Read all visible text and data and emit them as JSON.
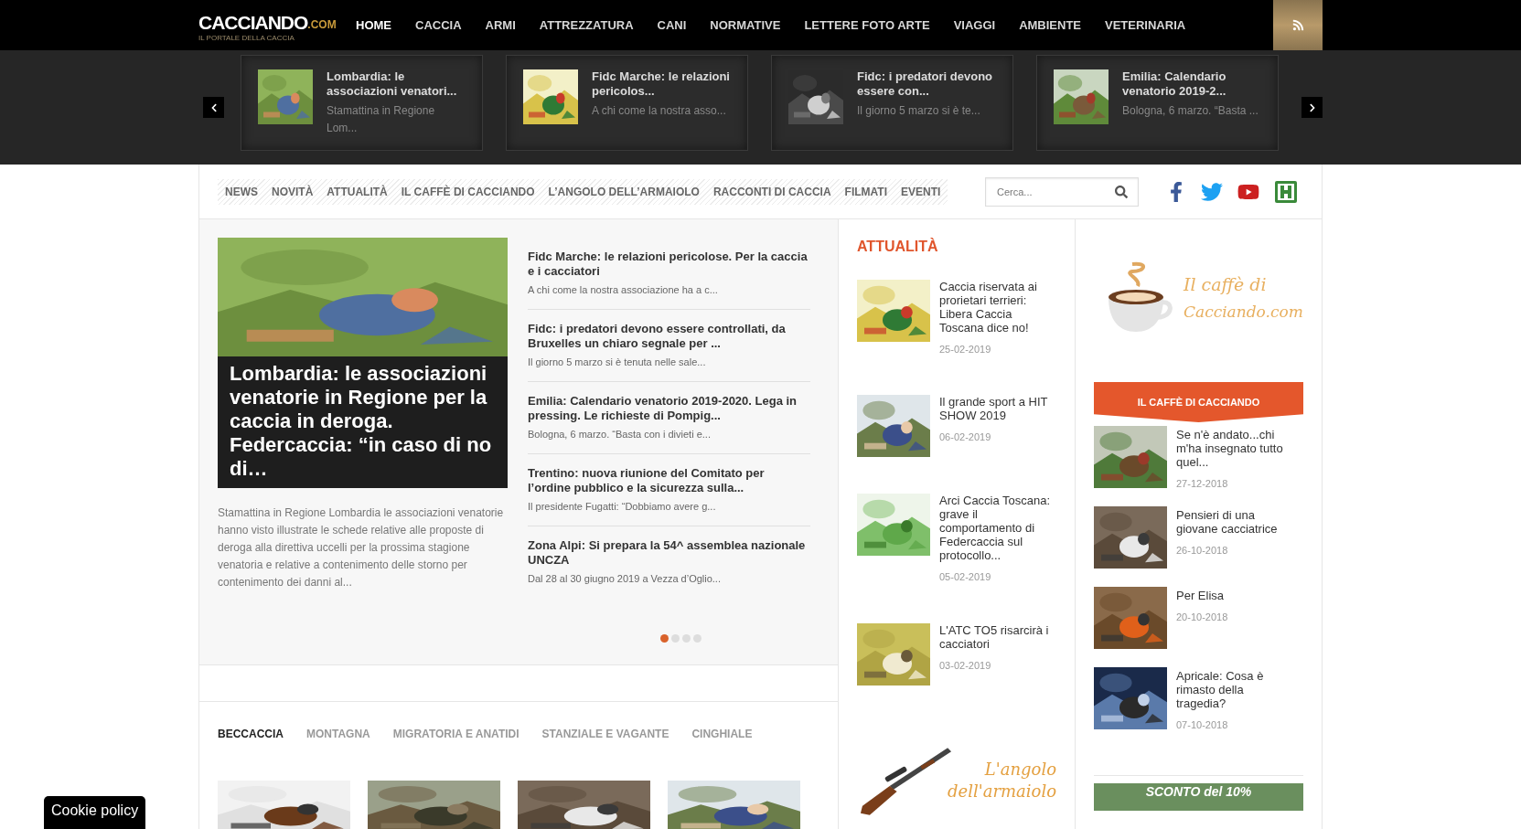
{
  "header": {
    "logo": "CACCIANDO",
    "logo_suffix": ".COM",
    "tagline": "IL PORTALE DELLA CACCIA",
    "nav": [
      {
        "label": "HOME",
        "selected": true
      },
      {
        "label": "CACCIA",
        "selected": false
      },
      {
        "label": "ARMI",
        "selected": false
      },
      {
        "label": "ATTREZZATURA",
        "selected": false
      },
      {
        "label": "CANI",
        "selected": false
      },
      {
        "label": "NORMATIVE",
        "selected": false
      },
      {
        "label": "LETTERE FOTO ARTE",
        "selected": false
      },
      {
        "label": "VIAGGI",
        "selected": false
      },
      {
        "label": "AMBIENTE",
        "selected": false
      },
      {
        "label": "VETERINARIA",
        "selected": false
      }
    ]
  },
  "carousel": {
    "items": [
      {
        "title": "Lombardia: le associazioni venatori...",
        "excerpt": "Stamattina in Regione Lom..."
      },
      {
        "title": "Fidc Marche: le relazioni pericolos...",
        "excerpt": "A chi come la nostra asso..."
      },
      {
        "title": "Fidc: i predatori devono essere con...",
        "excerpt": "Il giorno 5 marzo si è te..."
      },
      {
        "title": "Emilia: Calendario venatorio 2019-2...",
        "excerpt": "Bologna, 6 marzo. “Basta ..."
      }
    ]
  },
  "subnav": {
    "items": [
      "NEWS",
      "NOVITÀ",
      "ATTUALITÀ",
      "IL CAFFÈ DI CACCIANDO",
      "L’ANGOLO DELL’ARMAIOLO",
      "RACCONTI DI CACCIA",
      "FILMATI",
      "EVENTI"
    ],
    "search": {
      "placeholder": "Cerca..."
    }
  },
  "featured": {
    "title": "Lombardia: le associazioni venatorie in Regione per la caccia in deroga. Federcaccia: “in caso di no di…",
    "excerpt": "Stamattina in Regione Lombardia le associazioni venatorie hanno visto illustrate le schede relative alle proposte di deroga alla direttiva uccelli per la prossima stagione venatoria e relative a contenimento delle storno per contenimento dei danni al..."
  },
  "headlines": [
    {
      "title": "Fidc Marche: le relazioni pericolose. Per la caccia e i cacciatori",
      "excerpt": "A chi come la nostra associazione ha a c..."
    },
    {
      "title": "Fidc: i predatori devono essere controllati, da Bruxelles un chiaro segnale per ...",
      "excerpt": "Il giorno 5 marzo si è tenuta nelle sale..."
    },
    {
      "title": "Emilia: Calendario venatorio 2019-2020. Lega in pressing. Le richieste di Pompig...",
      "excerpt": "Bologna, 6 marzo. “Basta con i divieti e..."
    },
    {
      "title": "Trentino: nuova riunione del Comitato per l’ordine pubblico e la sicurezza sulla...",
      "excerpt": "Il presidente Fugatti: “Dobbiamo avere g..."
    },
    {
      "title": "Zona Alpi: Si prepara la 54^ assemblea nazionale UNCZA",
      "excerpt": "Dal 28 al 30 giugno 2019 a Vezza d’Oglio..."
    }
  ],
  "slider_dots": [
    {
      "selected": true
    },
    {
      "selected": false
    },
    {
      "selected": false
    },
    {
      "selected": false
    }
  ],
  "category_tabs": [
    {
      "label": "BECCACCIA",
      "selected": true
    },
    {
      "label": "MONTAGNA",
      "selected": false
    },
    {
      "label": "MIGRATORIA E ANATIDI",
      "selected": false
    },
    {
      "label": "STANZIALE E VAGANTE",
      "selected": false
    },
    {
      "label": "CINGHIALE",
      "selected": false
    }
  ],
  "attualita": {
    "heading": "ATTUALITÀ",
    "items": [
      {
        "title": "Caccia riservata ai prorietari terrieri: Libera Caccia Toscana dice no!",
        "date": "25-02-2019"
      },
      {
        "title": "Il grande sport a HIT SHOW 2019",
        "date": "06-02-2019"
      },
      {
        "title": "Arci Caccia Toscana: grave il comportamento di Federcaccia sul protocollo...",
        "date": "05-02-2019"
      },
      {
        "title": "L'ATC TO5 risarcirà i cacciatori",
        "date": "03-02-2019"
      }
    ]
  },
  "armaiolo_banner": {
    "line1": "L'angolo",
    "line2": "dell'armaiolo"
  },
  "caffe_banner": {
    "line1": "Il caffè di",
    "line2": "Cacciando.com"
  },
  "caffe": {
    "heading": "IL CAFFÈ DI CACCIANDO",
    "items": [
      {
        "title": "Se n'è andato...chi m'ha insegnato tutto quel...",
        "date": "27-12-2018"
      },
      {
        "title": "Pensieri di una giovane cacciatrice",
        "date": "26-10-2018"
      },
      {
        "title": "Per Elisa",
        "date": "20-10-2018"
      },
      {
        "title": "Apricale: Cosa è rimasto della tragedia?",
        "date": "07-10-2018"
      }
    ]
  },
  "promo": {
    "text": "SCONTO del 10%"
  },
  "cookie": {
    "label": "Cookie policy"
  }
}
